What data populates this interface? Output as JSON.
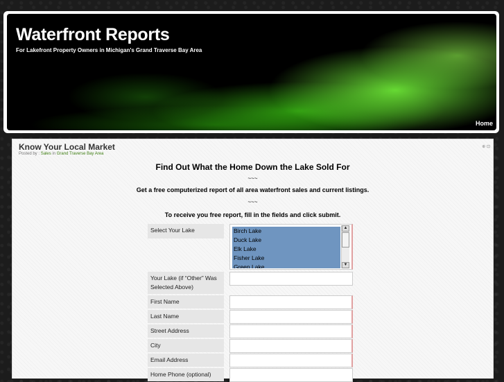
{
  "header": {
    "title": "Waterfront Reports",
    "tagline": "For Lakefront Property Owners in Michigan's Grand Traverse Bay Area",
    "nav_home": "Home"
  },
  "post": {
    "title": "Know Your Local Market",
    "meta_prefix": "Posted by :",
    "meta_author": "Sales",
    "meta_in": "in",
    "meta_category": "Grand Traverse Bay Area",
    "icons": "⊕ ⊡"
  },
  "content": {
    "headline": "Find Out What the Home Down the Lake Sold For",
    "tilde1": "~~~",
    "offer": "Get a free computerized report of all area waterfront sales and current listings.",
    "tilde2": "~~~",
    "instructions": "To receive you free report, fill in the fields and click submit."
  },
  "form": {
    "select_lake_label": "Select Your Lake",
    "lakes": [
      "Birch Lake",
      "Duck Lake",
      "Elk Lake",
      "Fisher Lake",
      "Green Lake"
    ],
    "other_lake_label_1": "Your Lake (if “Other” Was",
    "other_lake_label_2": "Selected Above)",
    "first_name_label": "First Name",
    "last_name_label": "Last Name",
    "street_label": "Street Address",
    "city_label": "City",
    "email_label": "Email Address",
    "home_phone_label": "Home Phone (optional)"
  },
  "colors": {
    "banner_green": "#5fe020",
    "select_highlight": "#6f95c0",
    "required_marker": "#e0a0a0"
  }
}
